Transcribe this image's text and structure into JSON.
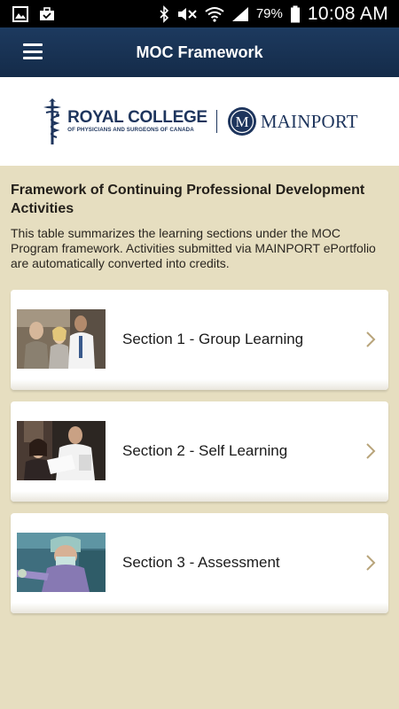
{
  "status_bar": {
    "icons": [
      "gallery-icon",
      "briefcase-icon",
      "bluetooth-icon",
      "mute-icon",
      "wifi-icon",
      "signal-icon",
      "battery-icon"
    ],
    "battery": "79%",
    "time": "10:08 AM"
  },
  "app_bar": {
    "title": "MOC Framework",
    "menu_icon": "hamburger-menu-icon"
  },
  "logo": {
    "college_name": "ROYAL COLLEGE",
    "college_subtitle": "OF PHYSICIANS AND SURGEONS OF CANADA",
    "mainport_letter": "M",
    "mainport_name": "MAINPORT"
  },
  "content": {
    "heading": "Framework of Continuing Professional Development Activities",
    "intro": "This table summarizes the learning sections under the MOC Program framework. Activities submitted via MAINPORT ePortfolio are automatically converted into credits."
  },
  "sections": [
    {
      "label": "Section 1 - Group Learning",
      "thumbnail": "group-learning-photo",
      "chevron": "chevron-right-icon"
    },
    {
      "label": "Section 2 - Self Learning",
      "thumbnail": "self-learning-photo",
      "chevron": "chevron-right-icon"
    },
    {
      "label": "Section 3 - Assessment",
      "thumbnail": "assessment-photo",
      "chevron": "chevron-right-icon"
    }
  ],
  "colors": {
    "status_bar": "#000000",
    "app_bar": "#1d3a5f",
    "background": "#e6dec0",
    "brand_navy": "#1e355d",
    "chevron": "#b8a47a"
  }
}
